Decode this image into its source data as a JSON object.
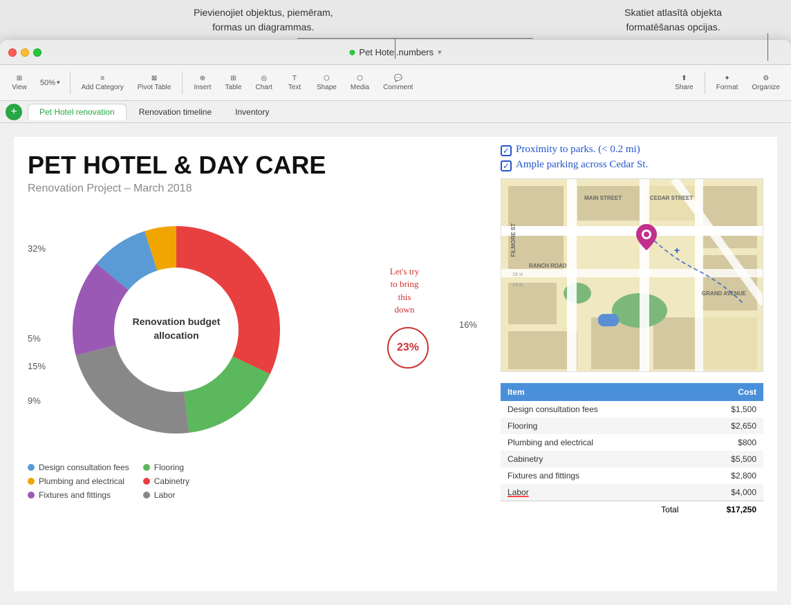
{
  "tooltips": {
    "left": "Pievienojiet objektus, piemēram,\nformas un diagrammas.",
    "right": "Skatiet atlasītā objekta\nformatēšanas opcijas."
  },
  "titlebar": {
    "title": "Pet Hotel.numbers",
    "chevron": "▾"
  },
  "toolbar": {
    "view_label": "View",
    "zoom_value": "50%",
    "zoom_chevron": "▾",
    "add_category_label": "Add Category",
    "pivot_table_label": "Pivot Table",
    "insert_label": "Insert",
    "table_label": "Table",
    "chart_label": "Chart",
    "text_label": "Text",
    "shape_label": "Shape",
    "media_label": "Media",
    "comment_label": "Comment",
    "share_label": "Share",
    "format_label": "Format",
    "organize_label": "Organize"
  },
  "tabs": {
    "tab1": "Pet Hotel renovation",
    "tab2": "Renovation timeline",
    "tab3": "Inventory"
  },
  "sheet": {
    "title": "PET HOTEL & DAY CARE",
    "subtitle": "Renovation Project – March 2018"
  },
  "chart": {
    "title": "Renovation budget\nallocation",
    "labels": {
      "l32": "32%",
      "l5": "5%",
      "l16": "16%",
      "l15": "15%",
      "l9": "9%"
    },
    "segments": [
      {
        "label": "Cabinetry",
        "color": "#e84040",
        "percent": 32
      },
      {
        "label": "Flooring",
        "color": "#5cb85c",
        "percent": 16
      },
      {
        "label": "Labor",
        "color": "#666666",
        "percent": 23
      },
      {
        "label": "Fixtures and fittings",
        "color": "#9b59b6",
        "percent": 15
      },
      {
        "label": "Design consultation fees",
        "color": "#5b9bd5",
        "percent": 9
      },
      {
        "label": "Plumbing and electrical",
        "color": "#f0a500",
        "percent": 5
      }
    ],
    "legend": [
      {
        "label": "Design consultation fees",
        "color": "#5b9bd5"
      },
      {
        "label": "Plumbing and electrical",
        "color": "#f0a500"
      },
      {
        "label": "Fixtures and fittings",
        "color": "#9b59b6"
      },
      {
        "label": "Flooring",
        "color": "#5cb85c"
      },
      {
        "label": "Cabinetry",
        "color": "#e84040"
      },
      {
        "label": "Labor",
        "color": "#666666"
      }
    ],
    "annotation_circle": "23%",
    "annotation_text": "Let's try\nto bring\nthis down"
  },
  "handwritten": {
    "line1": "Proximity to parks. (< 0.2 mi)",
    "line2": "Ample parking across  Cedar St."
  },
  "table": {
    "headers": [
      "Item",
      "Cost"
    ],
    "rows": [
      {
        "item": "Design consultation fees",
        "cost": "$1,500"
      },
      {
        "item": "Flooring",
        "cost": "$2,650"
      },
      {
        "item": "Plumbing and electrical",
        "cost": "$800"
      },
      {
        "item": "Cabinetry",
        "cost": "$5,500"
      },
      {
        "item": "Fixtures and fittings",
        "cost": "$2,800"
      },
      {
        "item": "Labor",
        "cost": "$4,000"
      }
    ],
    "total_label": "Total",
    "total_value": "$17,250"
  }
}
